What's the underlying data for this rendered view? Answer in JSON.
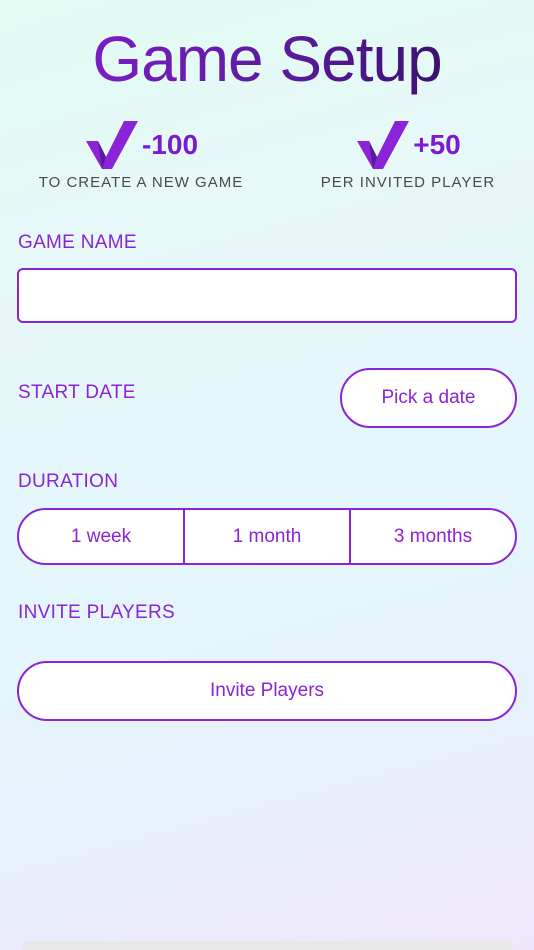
{
  "header": {
    "title": "Game Setup"
  },
  "costs": [
    {
      "value": "-100",
      "caption": "TO CREATE A NEW GAME",
      "icon": "check-logo-icon"
    },
    {
      "value": "+50",
      "caption": "PER INVITED PLAYER",
      "icon": "check-logo-icon"
    }
  ],
  "form": {
    "game_name_label": "GAME NAME",
    "game_name_value": "",
    "game_name_placeholder": "",
    "start_date_label": "START DATE",
    "pick_date_button": "Pick a date",
    "duration_label": "DURATION",
    "duration_options": [
      "1 week",
      "1 month",
      "3 months"
    ],
    "invite_label": "INVITE PLAYERS",
    "invite_button": "Invite Players"
  },
  "colors": {
    "accent": "#8a24d6",
    "text_muted": "#4a4a4a"
  }
}
